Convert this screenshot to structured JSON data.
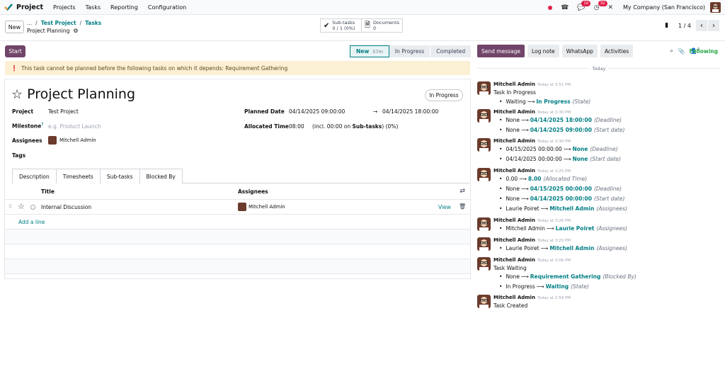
{
  "nav": {
    "app_name": "Project",
    "menu": [
      "Projects",
      "Tasks",
      "Reporting",
      "Configuration"
    ],
    "activity_badge": "10",
    "messages_badge": "32",
    "company": "My Company (San Francisco)"
  },
  "control": {
    "new_label": "New",
    "breadcrumb_sep": "/",
    "breadcrumb": [
      "...",
      "Test Project",
      "Tasks"
    ],
    "record_name": "Project Planning",
    "subtasks_label": "Sub-tasks",
    "subtasks_value": "0 / 1 (0%)",
    "documents_label": "Documents",
    "documents_value": "0",
    "pager": "1 / 4"
  },
  "statusbar": {
    "start_label": "Start",
    "stages": [
      {
        "label": "New",
        "sub": "57m",
        "active": true
      },
      {
        "label": "In Progress",
        "sub": "",
        "active": false
      },
      {
        "label": "Completed",
        "sub": "",
        "active": false
      }
    ]
  },
  "warning": "This task cannot be planned before the following tasks on which it depends: Requirement Gathering",
  "form": {
    "title": "Project Planning",
    "state": "In Progress",
    "project_label": "Project",
    "project_value": "Test Project",
    "milestone_label": "Milestone",
    "milestone_sup": "?",
    "milestone_placeholder": "e.g. Product Launch",
    "assignees_label": "Assignees",
    "assignee": "Mitchell Admin",
    "tags_label": "Tags",
    "planned_label": "Planned Date",
    "planned_start": "04/14/2025 09:00:00",
    "planned_end": "04/14/2025 18:00:00",
    "alloc_label": "Allocated Time",
    "alloc_value": "08:00",
    "alloc_note_pre": "(incl. 00:00 on ",
    "alloc_note_bold": "Sub-tasks",
    "alloc_note_post": ") (0%)"
  },
  "tabs": [
    "Description",
    "Timesheets",
    "Sub-tasks",
    "Blocked By"
  ],
  "subtasks": {
    "col_title": "Title",
    "col_assignees": "Assignees",
    "rows": [
      {
        "title": "Internal Discussion",
        "assignee": "Mitchell Admin",
        "action": "View"
      }
    ],
    "add_line": "Add a line"
  },
  "chatter": {
    "send_label": "Send message",
    "log_label": "Log note",
    "whatsapp_label": "WhatsApp",
    "activities_label": "Activities",
    "followers_count": "2",
    "following_label": "Following",
    "day_label": "Today",
    "messages": [
      {
        "author": "Mitchell Admin",
        "time": "Today at 3:51 PM",
        "body": "Task In Progress",
        "lines": [
          {
            "old": "Waiting",
            "new": "In Progress",
            "field": "(State)"
          }
        ]
      },
      {
        "author": "Mitchell Admin",
        "time": "Today at 3:30 PM",
        "body": "",
        "lines": [
          {
            "old": "None",
            "new": "04/14/2025 18:00:00",
            "field": "(Deadline)"
          },
          {
            "old": "None",
            "new": "04/14/2025 09:00:00",
            "field": "(Start date)"
          }
        ]
      },
      {
        "author": "Mitchell Admin",
        "time": "Today at 3:30 PM",
        "body": "",
        "lines": [
          {
            "old": "04/15/2025 00:00:00",
            "new": "None",
            "field": "(Deadline)"
          },
          {
            "old": "04/14/2025 00:00:00",
            "new": "None",
            "field": "(Start date)"
          }
        ]
      },
      {
        "author": "Mitchell Admin",
        "time": "Today at 3:25 PM",
        "body": "",
        "lines": [
          {
            "old": "0.00",
            "new": "8.00",
            "field": "(Allocated Time)"
          },
          {
            "old": "None",
            "new": "04/15/2025 00:00:00",
            "field": "(Deadline)"
          },
          {
            "old": "None",
            "new": "04/14/2025 00:00:00",
            "field": "(Start date)"
          },
          {
            "old": "Laurie Poiret",
            "new": "Mitchell Admin",
            "field": "(Assignees)"
          }
        ]
      },
      {
        "author": "Mitchell Admin",
        "time": "Today at 3:26 PM",
        "body": "",
        "lines": [
          {
            "old": "Mitchell Admin",
            "new": "Laurie Poiret",
            "field": "(Assignees)"
          }
        ]
      },
      {
        "author": "Mitchell Admin",
        "time": "Today at 3:23 PM",
        "body": "",
        "lines": [
          {
            "old": "Laurie Poiret",
            "new": "Mitchell Admin",
            "field": "(Assignees)"
          }
        ]
      },
      {
        "author": "Mitchell Admin",
        "time": "Today at 3:06 PM",
        "body": "Task Waiting",
        "lines": [
          {
            "old": "None",
            "new": "Requirement Gathering",
            "field": "(Blocked By)"
          },
          {
            "old": "In Progress",
            "new": "Waiting",
            "field": "(State)"
          }
        ]
      },
      {
        "author": "Mitchell Admin",
        "time": "Today at 2:59 PM",
        "body": "Task Created",
        "lines": []
      }
    ]
  }
}
